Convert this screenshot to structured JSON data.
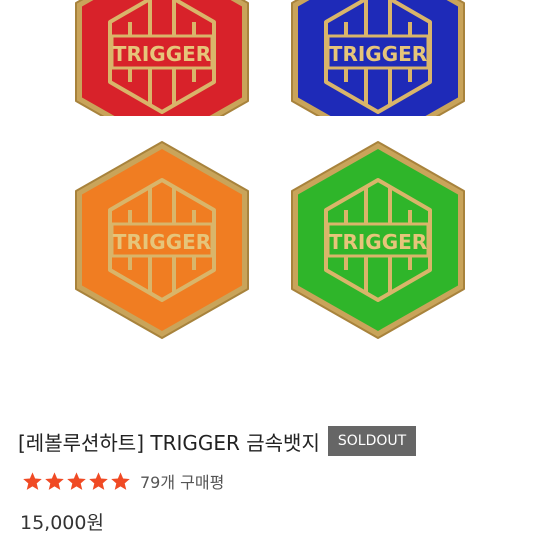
{
  "product": {
    "badges": [
      {
        "label": "TRIGGER",
        "color": "#d8222a"
      },
      {
        "label": "TRIGGER",
        "color": "#1e2ab8"
      },
      {
        "label": "TRIGGER",
        "color": "#f07d22"
      },
      {
        "label": "TRIGGER",
        "color": "#2fb52a"
      }
    ],
    "title": "[레볼루션하트] TRIGGER 금속뱃지",
    "status_badge": "SOLDOUT",
    "rating": {
      "stars": 5,
      "max": 5,
      "review_count_text": "79개 구매평",
      "star_color": "#f04a24"
    },
    "price": "15,000원"
  }
}
